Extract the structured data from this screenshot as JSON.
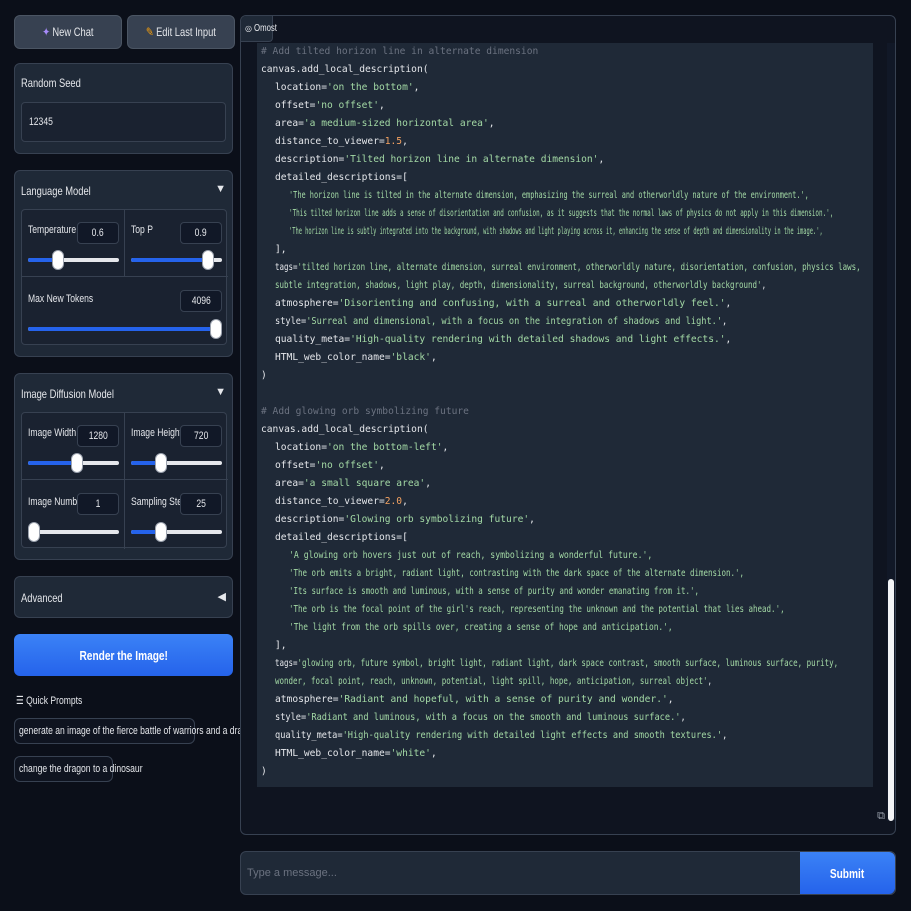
{
  "top_buttons": {
    "new_chat": "New Chat",
    "edit_last_input": "Edit Last Input"
  },
  "random_seed": {
    "label": "Random Seed",
    "value": "12345"
  },
  "language_model": {
    "title": "Language Model",
    "temperature": {
      "label": "Temperature",
      "value": "0.6",
      "fraction": 0.3
    },
    "top_p": {
      "label": "Top P",
      "value": "0.9",
      "fraction": 0.9
    },
    "max_new_tokens": {
      "label": "Max New Tokens",
      "value": "4096",
      "fraction": 1.0
    }
  },
  "image_diffusion": {
    "title": "Image Diffusion Model",
    "image_width": {
      "label": "Image Width",
      "value": "1280",
      "fraction": 0.55
    },
    "image_height": {
      "label": "Image Height",
      "value": "720",
      "fraction": 0.3
    },
    "image_number": {
      "label": "Image Number",
      "value": "1",
      "fraction": 0.0
    },
    "sampling_steps": {
      "label": "Sampling Steps",
      "value": "25",
      "fraction": 0.3
    }
  },
  "advanced": {
    "title": "Advanced"
  },
  "render_button": "Render the Image!",
  "quick_prompts": {
    "title": "☰ Quick Prompts",
    "items": [
      "generate an image of the fierce battle of warriors and a dragon",
      "change the dragon to a dinosaur"
    ]
  },
  "chat": {
    "tab_label": "Omost",
    "input_placeholder": "Type a message...",
    "submit_label": "Submit"
  },
  "code": {
    "block1": {
      "comment": "# Add tilted horizon line in alternate dimension",
      "call": "canvas.add_local_description(",
      "location": "'on the bottom'",
      "offset": "'no offset'",
      "area": "'a medium-sized horizontal area'",
      "distance": "1.5",
      "description": "'Tilted horizon line in alternate dimension'",
      "details": [
        "'The horizon line is tilted in the alternate dimension, emphasizing the surreal and otherworldly nature of the environment.',",
        "'This tilted horizon line adds a sense of disorientation and confusion, as it suggests that the normal laws of physics do not apply in this dimension.',",
        "'The horizon line is subtly integrated into the background, with shadows and light playing across it, enhancing the sense of depth and dimensionality in the image.',"
      ],
      "tags": "'tilted horizon line, alternate dimension, surreal environment, otherworldly nature, disorientation, confusion, physics laws, subtle integration, shadows, light play, depth, dimensionality, surreal background, otherworldly background'",
      "atmosphere": "'Disorienting and confusing, with a surreal and otherworldly feel.'",
      "style": "'Surreal and dimensional, with a focus on the integration of shadows and light.'",
      "quality_meta": "'High-quality rendering with detailed shadows and light effects.'",
      "color": "'black'"
    },
    "block2": {
      "comment": "# Add glowing orb symbolizing future",
      "call": "canvas.add_local_description(",
      "location": "'on the bottom-left'",
      "offset": "'no offset'",
      "area": "'a small square area'",
      "distance": "2.0",
      "description": "'Glowing orb symbolizing future'",
      "details": [
        "'A glowing orb hovers just out of reach, symbolizing a wonderful future.',",
        "'The orb emits a bright, radiant light, contrasting with the dark space of the alternate dimension.',",
        "'Its surface is smooth and luminous, with a sense of purity and wonder emanating from it.',",
        "'The orb is the focal point of the girl's reach, representing the unknown and the potential that lies ahead.',",
        "'The light from the orb spills over, creating a sense of hope and anticipation.',"
      ],
      "tags": "'glowing orb, future symbol, bright light, radiant light, dark space contrast, smooth surface, luminous surface, purity, wonder, focal point, reach, unknown, potential, light spill, hope, anticipation, surreal object'",
      "atmosphere": "'Radiant and hopeful, with a sense of purity and wonder.'",
      "style": "'Radiant and luminous, with a focus on the smooth and luminous surface.'",
      "quality_meta": "'High-quality rendering with detailed light effects and smooth textures.'",
      "color": "'white'"
    },
    "keys": {
      "location": "location=",
      "offset": "offset=",
      "area": "area=",
      "distance": "distance_to_viewer=",
      "description": "description=",
      "details": "detailed_descriptions=[",
      "close_bracket": "],",
      "tags": "tags=",
      "atmosphere": "atmosphere=",
      "style": "style=",
      "quality_meta": "quality_meta=",
      "color": "HTML_web_color_name=",
      "close_paren": ")",
      "comma": ","
    }
  }
}
